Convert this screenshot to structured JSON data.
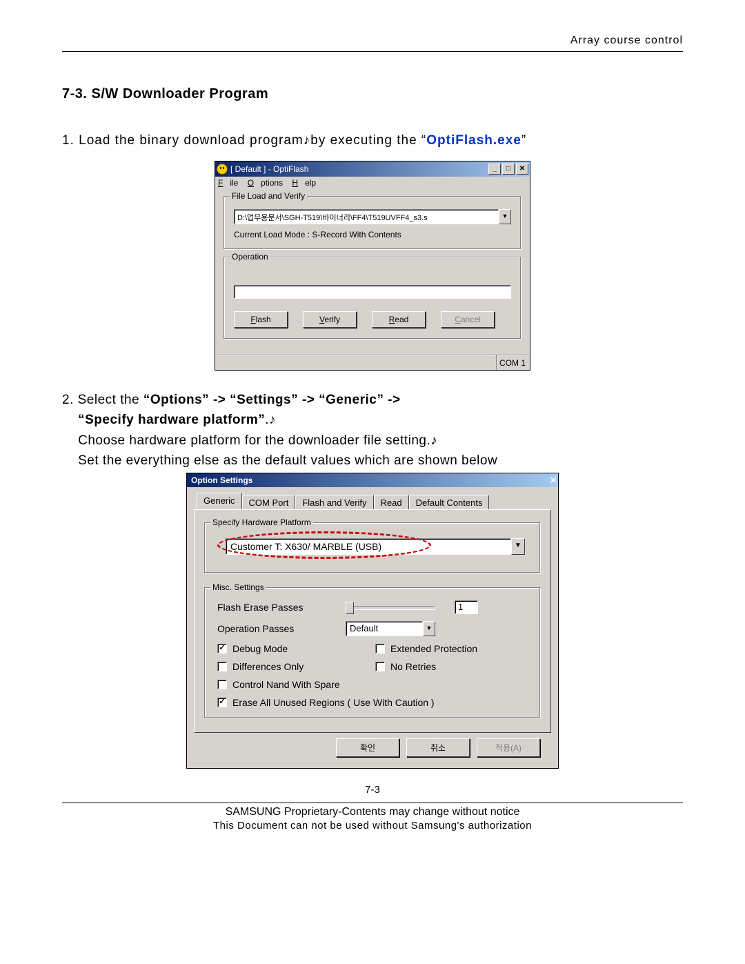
{
  "header": {
    "right": "Array course control"
  },
  "section_title": "7-3. S/W Downloader Program",
  "step1": {
    "prefix": "1. Load the binary download program",
    "middle": "by executing the ",
    "quote_open": "“",
    "exe": "OptiFlash.exe",
    "quote_close": "”"
  },
  "optiflash": {
    "title": "[ Default ] - OptiFlash",
    "menu": {
      "file": "File",
      "file_u": "F",
      "options": "Options",
      "options_u": "O",
      "help": "Help",
      "help_u": "H"
    },
    "g1": {
      "legend": "File Load and Verify",
      "path": "D:\\업무용문서\\SGH-T519\\바이너리\\FF4\\T519UVFF4_s3.s",
      "status": "Current Load Mode : S-Record With Contents"
    },
    "g2": {
      "legend": "Operation"
    },
    "buttons": {
      "flash": "Flash",
      "flash_u": "F",
      "verify": "Verify",
      "verify_u": "V",
      "read": "Read",
      "read_u": "R",
      "cancel": "Cancel",
      "cancel_u": "C"
    },
    "status_cell": "COM 1"
  },
  "step2": {
    "l1a": "2. Select the ",
    "l1b": "“Options” -> “Settings” -> “Generic” ->",
    "l2a": "“Specify hardware platform”",
    "l2b": ".",
    "l3": "Choose hardware platform for the downloader file setting.",
    "l4": "Set the everything else as the default values which are shown below"
  },
  "options": {
    "title": "Option Settings",
    "tabs": [
      "Generic",
      "COM Port",
      "Flash and Verify",
      "Read",
      "Default Contents"
    ],
    "g1": {
      "legend": "Specify Hardware Platform",
      "value": "Customer T: X630/ MARBLE (USB)"
    },
    "g2": {
      "legend": "Misc. Settings",
      "flash_passes_label": "Flash Erase Passes",
      "flash_passes_value": "1",
      "op_passes_label": "Operation Passes",
      "op_passes_value": "Default",
      "debug": "Debug Mode",
      "ext_protect": "Extended Protection",
      "diff_only": "Differences Only",
      "no_retries": "No Retries",
      "nand_spare": "Control Nand With Spare",
      "erase_unused": "Erase All Unused Regions ( Use With Caution )"
    },
    "dlg_buttons": {
      "ok": "확인",
      "cancel": "취소",
      "apply": "적용(A)"
    }
  },
  "footer": {
    "page": "7-3",
    "line1": "SAMSUNG Proprietary-Contents may change without notice",
    "line2": "This Document can not be used without Samsung's authorization"
  }
}
